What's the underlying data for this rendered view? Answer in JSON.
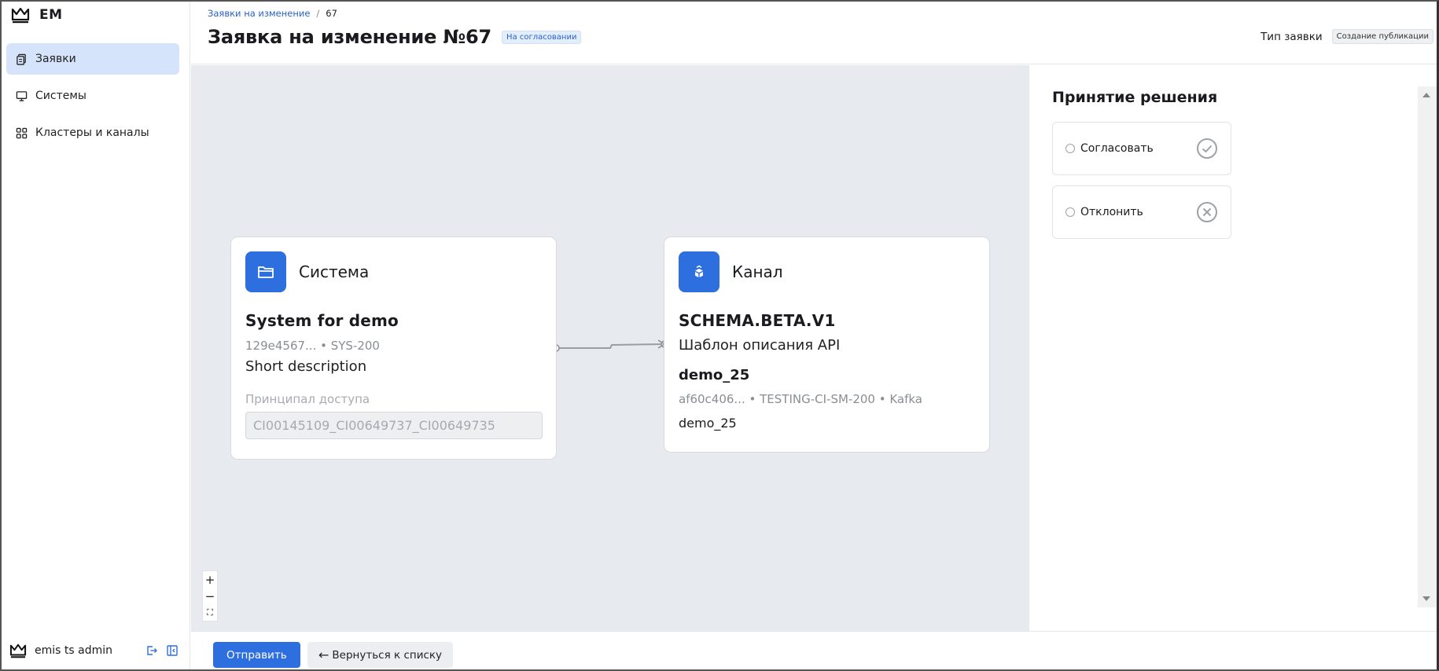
{
  "app": {
    "logo_text": "EM"
  },
  "sidebar": {
    "items": [
      {
        "label": "Заявки",
        "icon": "documents-icon",
        "active": true
      },
      {
        "label": "Системы",
        "icon": "monitor-icon",
        "active": false
      },
      {
        "label": "Кластеры и каналы",
        "icon": "grid-icon",
        "active": false
      }
    ],
    "user": {
      "name": "emis ts admin"
    }
  },
  "header": {
    "breadcrumb": {
      "parent": "Заявки на изменение",
      "separator": "/",
      "current": "67"
    },
    "title": "Заявка на изменение №67",
    "status": "На согласовании",
    "type_label": "Тип заявки",
    "type_value": "Создание публикации"
  },
  "graph": {
    "system_node": {
      "kind": "Система",
      "name": "System for demo",
      "meta": "129e4567... • SYS-200",
      "description": "Short description",
      "principal_label": "Принципал доступа",
      "principal_value": "CI00145109_CI00649737_CI00649735"
    },
    "channel_node": {
      "kind": "Канал",
      "name": "SCHEMA.BETA.V1",
      "description": "Шаблон описания API",
      "topic": "demo_25",
      "meta": "af60c406... • TESTING-CI-SM-200 • Kafka",
      "topic_plain": "demo_25"
    },
    "zoom": {
      "in": "+",
      "out": "−",
      "fit": "⛶"
    }
  },
  "decision": {
    "title": "Принятие решения",
    "options": [
      {
        "label": "Согласовать",
        "icon": "check-circle-icon"
      },
      {
        "label": "Отклонить",
        "icon": "x-circle-icon"
      }
    ]
  },
  "footer": {
    "submit": "Отправить",
    "back": "Вернуться к списку",
    "back_arrow": "←"
  },
  "colors": {
    "accent": "#2e6fe0",
    "active_nav": "#d6e4fb",
    "canvas": "#e7ebef"
  }
}
